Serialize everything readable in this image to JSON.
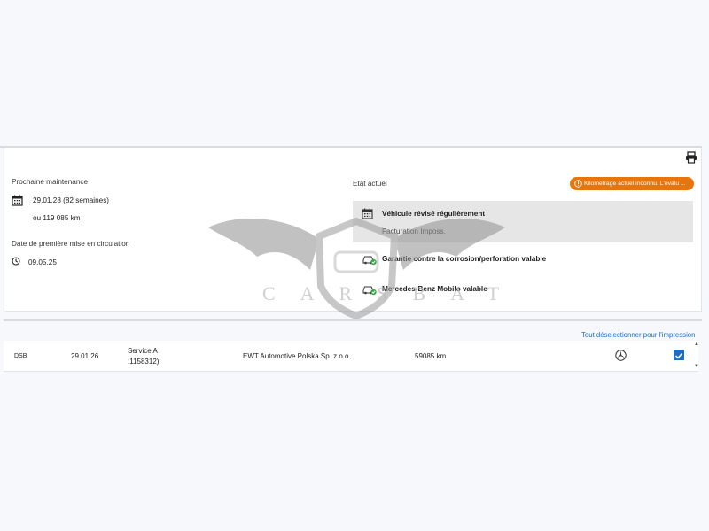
{
  "maintenance": {
    "next_label": "Prochaine maintenance",
    "next_date": "29.01.28 (82 semaines)",
    "next_km": "ou 119 085 km",
    "first_reg_label": "Date de première mise en circulation",
    "first_reg_date": "09.05.25"
  },
  "status": {
    "label": "Etat actuel",
    "badge_text": "Kilométrage actuel inconnu. L'évalu ...",
    "badge_color": "#e8750b",
    "serviced_title": "Véhicule révisé régulièrement",
    "serviced_sub": "Facturation Imposs.",
    "warranty": "Garantie contre la corrosion/perforation valable",
    "mobilo": "Mercedes-Benz Mobilo valable"
  },
  "watermark": {
    "text": "CARSBAT"
  },
  "history": {
    "deselect_link": "Tout déselectionner pour l'impression",
    "rows": [
      {
        "code": "DSB",
        "date": "29.01.26",
        "service_line1": "Service A",
        "service_line2": ":1158312)",
        "dealer": "EWT Automotive Polska Sp. z o.o.",
        "mileage": "59085 km",
        "checked": true
      }
    ]
  },
  "icons": {
    "print": "printer-icon",
    "calendar": "calendar-icon",
    "clock": "clock-icon",
    "warning": "warning-circle-icon",
    "car_check": "car-check-icon",
    "mercedes": "mercedes-star-icon"
  },
  "colors": {
    "accent": "#1a6fc4",
    "check_green": "#3aa84a"
  }
}
